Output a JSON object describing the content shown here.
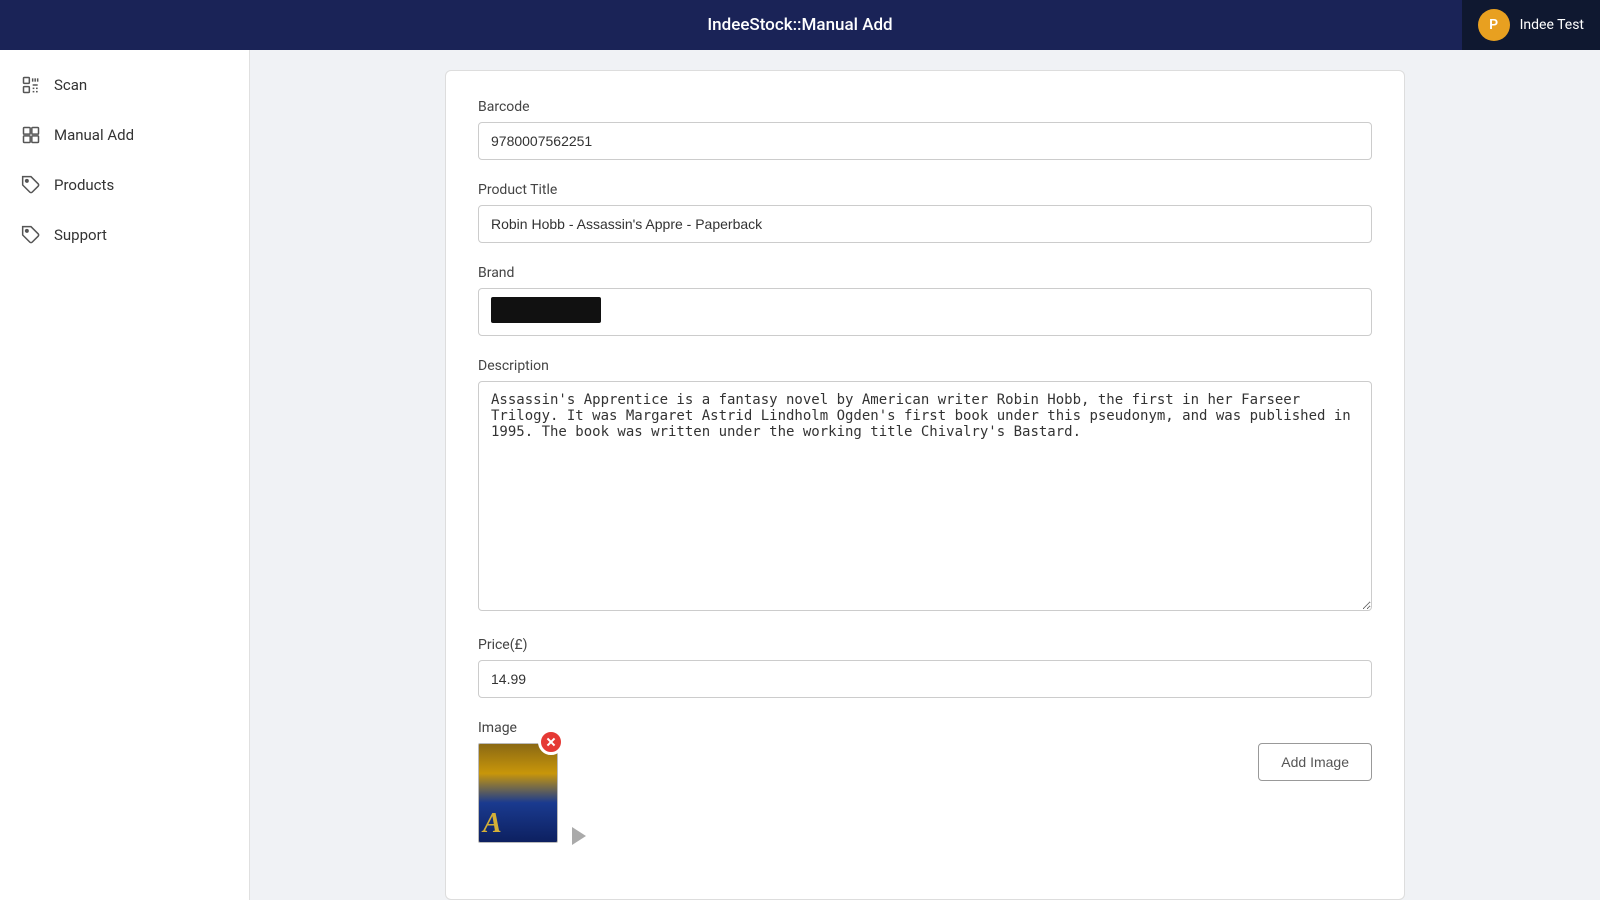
{
  "header": {
    "title": "IndeeStock::Manual Add",
    "user": {
      "initial": "P",
      "name": "Indee Test"
    }
  },
  "sidebar": {
    "items": [
      {
        "id": "scan",
        "label": "Scan",
        "icon": "scan-icon"
      },
      {
        "id": "manual-add",
        "label": "Manual Add",
        "icon": "grid-icon"
      },
      {
        "id": "products",
        "label": "Products",
        "icon": "tag-icon"
      },
      {
        "id": "support",
        "label": "Support",
        "icon": "support-icon"
      }
    ]
  },
  "form": {
    "barcode_label": "Barcode",
    "barcode_value": "9780007562251",
    "product_title_label": "Product Title",
    "product_title_value": "Robin Hobb - Assassin's Appre - Paperback",
    "brand_label": "Brand",
    "description_label": "Description",
    "description_value": "Assassin's Apprentice is a fantasy novel by American writer Robin Hobb, the first in her Farseer Trilogy. It was Margaret Astrid Lindholm Ogden's first book under this pseudonym, and was published in 1995. The book was written under the working title Chivalry's Bastard.",
    "price_label": "Price(£)",
    "price_value": "14.99",
    "image_label": "Image",
    "add_image_label": "Add Image"
  }
}
